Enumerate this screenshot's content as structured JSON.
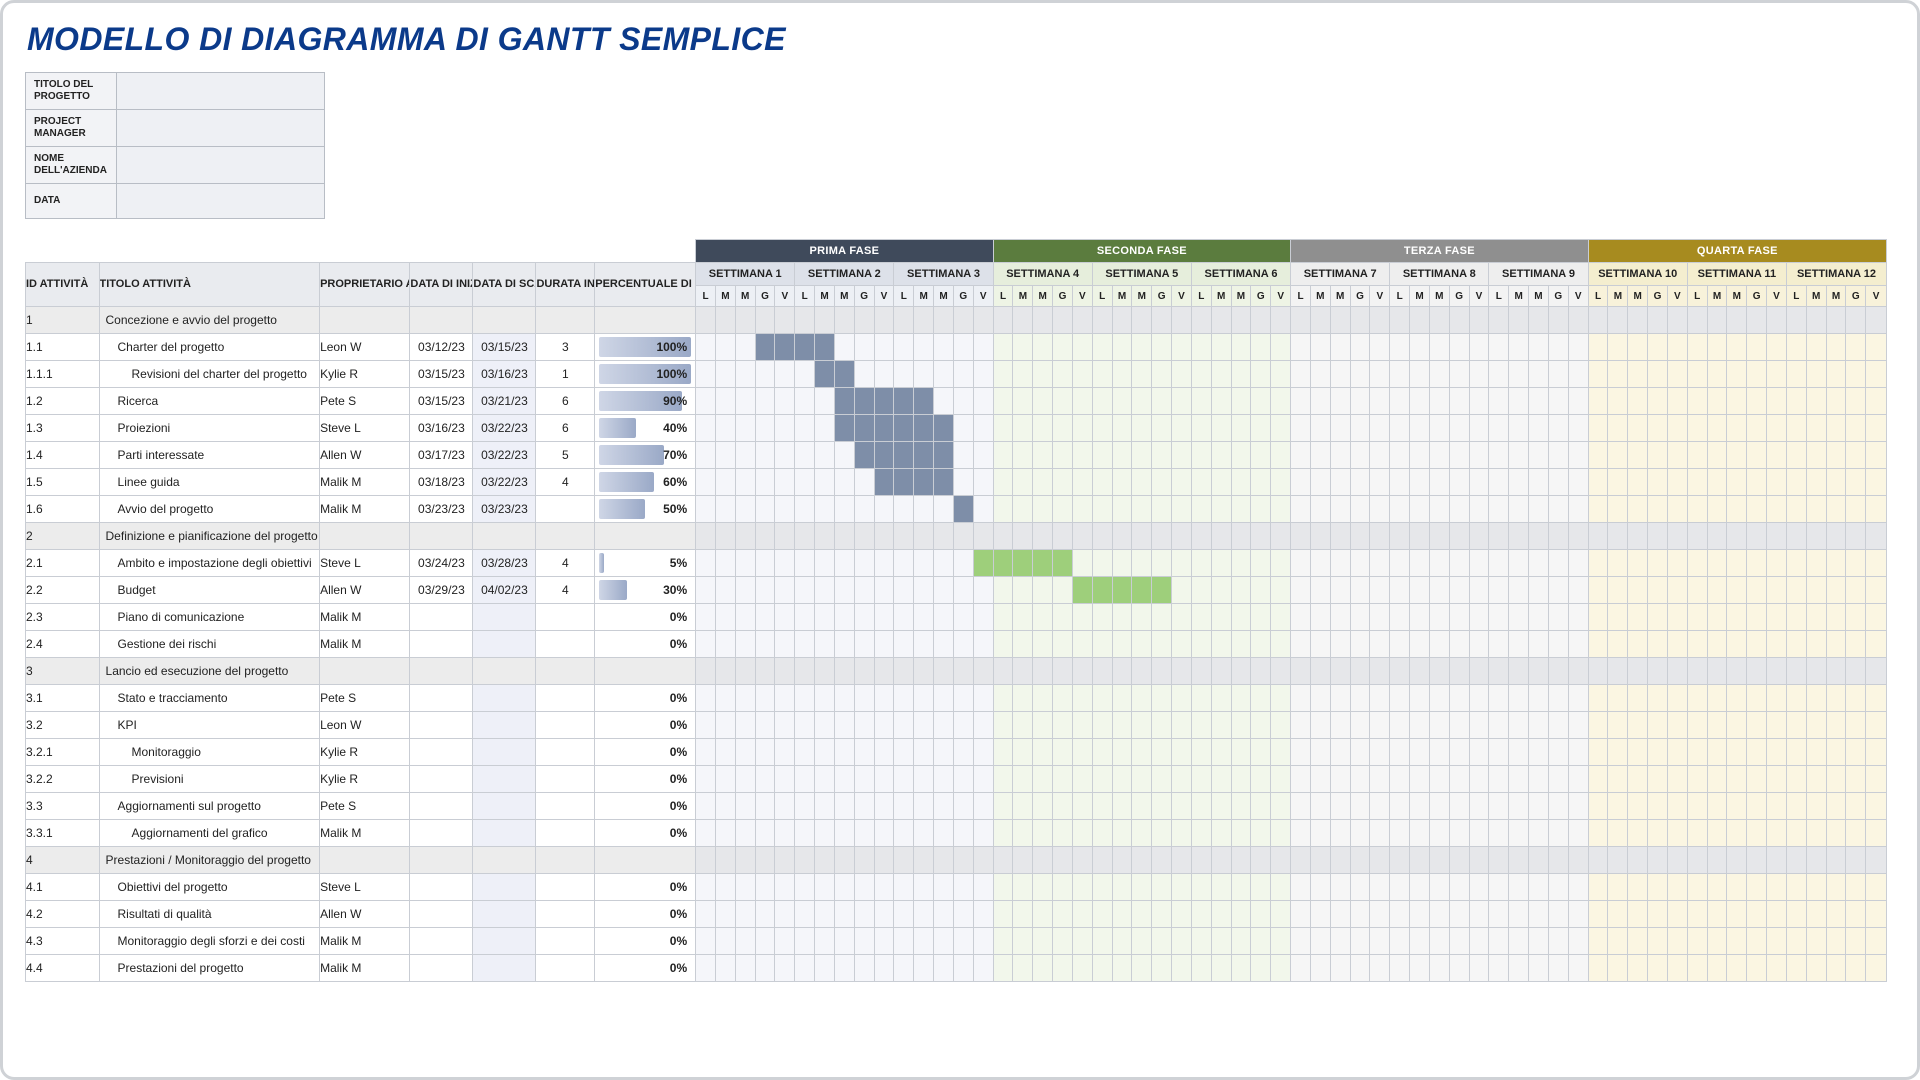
{
  "title": "MODELLO DI DIAGRAMMA DI GANTT SEMPLICE",
  "meta": {
    "labels": {
      "project_title": "TITOLO DEL PROGETTO",
      "pm": "PROJECT MANAGER",
      "company": "NOME DELL'AZIENDA",
      "date": "DATA"
    },
    "values": {
      "project_title": "",
      "pm": "",
      "company": "",
      "date": ""
    }
  },
  "columns": {
    "id": "ID ATTIVITÀ",
    "name": "TITOLO ATTIVITÀ",
    "owner": "PROPRIETARIO ATTIVITÀ",
    "start": "DATA DI INIZIO",
    "end": "DATA DI SCADENZA",
    "dur": "DURATA IN GIORNI",
    "pct": "PERCENTUALE DI COMPLETAMENTO ATTIVITÀ"
  },
  "phases": [
    {
      "label": "PRIMA FASE",
      "cls": "1",
      "weeks": [
        "SETTIMANA 1",
        "SETTIMANA 2",
        "SETTIMANA 3"
      ]
    },
    {
      "label": "SECONDA FASE",
      "cls": "2",
      "weeks": [
        "SETTIMANA 4",
        "SETTIMANA 5",
        "SETTIMANA 6"
      ]
    },
    {
      "label": "TERZA FASE",
      "cls": "3",
      "weeks": [
        "SETTIMANA 7",
        "SETTIMANA 8",
        "SETTIMANA 9"
      ]
    },
    {
      "label": "QUARTA FASE",
      "cls": "4",
      "weeks": [
        "SETTIMANA 10",
        "SETTIMANA 11",
        "SETTIMANA 12"
      ]
    }
  ],
  "days": [
    "L",
    "M",
    "M",
    "G",
    "V"
  ],
  "colors": {
    "phase1": "#3f4a5b",
    "phase2": "#5b7c3e",
    "phase3": "#8f8f8f",
    "phase4": "#a78b1f"
  },
  "rows": [
    {
      "id": "1",
      "section": true,
      "name": "Concezione e avvio del progetto"
    },
    {
      "id": "1.1",
      "name": "Charter del progetto",
      "owner": "Leon W",
      "start": "03/12/23",
      "end": "03/15/23",
      "dur": "3",
      "pct": 100,
      "indent": 1,
      "bar": {
        "phase": 1,
        "from": 4,
        "to": 7
      }
    },
    {
      "id": "1.1.1",
      "name": "Revisioni del charter del progetto",
      "owner": "Kylie R",
      "start": "03/15/23",
      "end": "03/16/23",
      "dur": "1",
      "pct": 100,
      "indent": 2,
      "bar": {
        "phase": 1,
        "from": 7,
        "to": 8
      }
    },
    {
      "id": "1.2",
      "name": "Ricerca",
      "owner": "Pete S",
      "start": "03/15/23",
      "end": "03/21/23",
      "dur": "6",
      "pct": 90,
      "indent": 1,
      "bar": {
        "phase": 1,
        "from": 8,
        "to": 12
      }
    },
    {
      "id": "1.3",
      "name": "Proiezioni",
      "owner": "Steve L",
      "start": "03/16/23",
      "end": "03/22/23",
      "dur": "6",
      "pct": 40,
      "indent": 1,
      "bar": {
        "phase": 1,
        "from": 8,
        "to": 13
      }
    },
    {
      "id": "1.4",
      "name": "Parti interessate",
      "owner": "Allen W",
      "start": "03/17/23",
      "end": "03/22/23",
      "dur": "5",
      "pct": 70,
      "indent": 1,
      "bar": {
        "phase": 1,
        "from": 9,
        "to": 13
      }
    },
    {
      "id": "1.5",
      "name": "Linee guida",
      "owner": "Malik M",
      "start": "03/18/23",
      "end": "03/22/23",
      "dur": "4",
      "pct": 60,
      "indent": 1,
      "bar": {
        "phase": 1,
        "from": 10,
        "to": 13
      }
    },
    {
      "id": "1.6",
      "name": "Avvio del progetto",
      "owner": "Malik M",
      "start": "03/23/23",
      "end": "03/23/23",
      "dur": "",
      "pct": 50,
      "indent": 1,
      "bar": {
        "phase": 1,
        "from": 14,
        "to": 14
      }
    },
    {
      "id": "2",
      "section": true,
      "name": "Definizione e pianificazione del progetto"
    },
    {
      "id": "2.1",
      "name": "Ambito e impostazione degli obiettivi",
      "owner": "Steve L",
      "start": "03/24/23",
      "end": "03/28/23",
      "dur": "4",
      "pct": 5,
      "indent": 1,
      "bar": {
        "phase": 2,
        "from": 15,
        "to": 19
      }
    },
    {
      "id": "2.2",
      "name": "Budget",
      "owner": "Allen W",
      "start": "03/29/23",
      "end": "04/02/23",
      "dur": "4",
      "pct": 30,
      "indent": 1,
      "bar": {
        "phase": 2,
        "from": 20,
        "to": 24
      }
    },
    {
      "id": "2.3",
      "name": "Piano di comunicazione",
      "owner": "Malik M",
      "start": "",
      "end": "",
      "dur": "",
      "pct": 0,
      "indent": 1
    },
    {
      "id": "2.4",
      "name": "Gestione dei rischi",
      "owner": "Malik M",
      "start": "",
      "end": "",
      "dur": "",
      "pct": 0,
      "indent": 1
    },
    {
      "id": "3",
      "section": true,
      "name": "Lancio ed esecuzione del progetto"
    },
    {
      "id": "3.1",
      "name": "Stato e tracciamento",
      "owner": "Pete S",
      "start": "",
      "end": "",
      "dur": "",
      "pct": 0,
      "indent": 1
    },
    {
      "id": "3.2",
      "name": "KPI",
      "owner": "Leon W",
      "start": "",
      "end": "",
      "dur": "",
      "pct": 0,
      "indent": 1
    },
    {
      "id": "3.2.1",
      "name": "Monitoraggio",
      "owner": "Kylie R",
      "start": "",
      "end": "",
      "dur": "",
      "pct": 0,
      "indent": 2
    },
    {
      "id": "3.2.2",
      "name": "Previsioni",
      "owner": "Kylie R",
      "start": "",
      "end": "",
      "dur": "",
      "pct": 0,
      "indent": 2
    },
    {
      "id": "3.3",
      "name": "Aggiornamenti sul progetto",
      "owner": "Pete S",
      "start": "",
      "end": "",
      "dur": "",
      "pct": 0,
      "indent": 1
    },
    {
      "id": "3.3.1",
      "name": "Aggiornamenti del grafico",
      "owner": "Malik M",
      "start": "",
      "end": "",
      "dur": "",
      "pct": 0,
      "indent": 2
    },
    {
      "id": "4",
      "section": true,
      "name": "Prestazioni / Monitoraggio del progetto"
    },
    {
      "id": "4.1",
      "name": "Obiettivi del progetto",
      "owner": "Steve L",
      "start": "",
      "end": "",
      "dur": "",
      "pct": 0,
      "indent": 1
    },
    {
      "id": "4.2",
      "name": "Risultati di qualità",
      "owner": "Allen W",
      "start": "",
      "end": "",
      "dur": "",
      "pct": 0,
      "indent": 1
    },
    {
      "id": "4.3",
      "name": "Monitoraggio degli sforzi e dei costi",
      "owner": "Malik M",
      "start": "",
      "end": "",
      "dur": "",
      "pct": 0,
      "indent": 1
    },
    {
      "id": "4.4",
      "name": "Prestazioni del progetto",
      "owner": "Malik M",
      "start": "",
      "end": "",
      "dur": "",
      "pct": 0,
      "indent": 1
    }
  ]
}
